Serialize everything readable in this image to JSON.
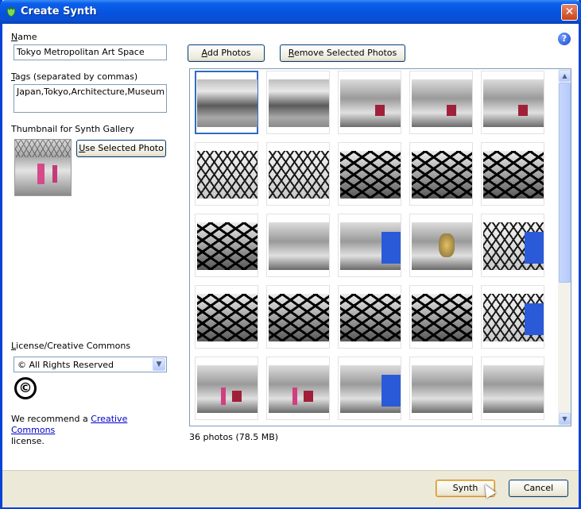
{
  "window": {
    "title": "Create Synth",
    "icon": "synth-leaf-icon",
    "close_glyph": "✕"
  },
  "help_glyph": "?",
  "name": {
    "label": "Name",
    "value": "Tokyo Metropolitan Art Space"
  },
  "tags": {
    "label": "Tags (separated by commas)",
    "value": "Japan,Tokyo,Architecture,Museum"
  },
  "thumbnail": {
    "label": "Thumbnail for Synth Gallery",
    "button": "Use Selected Photo"
  },
  "license": {
    "label": "License/Creative Commons",
    "selected": "© All Rights Reserved",
    "icon_glyph": "©",
    "arrow_glyph": "▼"
  },
  "recommend": {
    "prefix": "We recommend a ",
    "link": "Creative Commons",
    "suffix": "license."
  },
  "toolbar": {
    "add_photos": "Add Photos",
    "remove_selected": "Remove Selected Photos"
  },
  "grid": {
    "selected_index": 0,
    "photos": [
      "hall-lattice",
      "hall-lattice",
      "hall-red-stairs",
      "hall-red-stairs",
      "hall-red-stairs",
      "lattice-roof",
      "lattice-roof",
      "lattice-dark",
      "lattice-dark",
      "lattice-dark",
      "lattice-dark",
      "hall-balcony",
      "hall-blue",
      "hall-tree",
      "lattice-blue",
      "lattice-dark",
      "lattice-dark",
      "lattice-dark",
      "lattice-dark",
      "lattice-blue",
      "hall-pink",
      "hall-pink",
      "hall-blue",
      "hall-balcony",
      "hall-balcony"
    ],
    "scroll_up_glyph": "▲",
    "scroll_down_glyph": "▼"
  },
  "status": "36 photos (78.5 MB)",
  "footer": {
    "synth": "Synth",
    "cancel": "Cancel"
  }
}
